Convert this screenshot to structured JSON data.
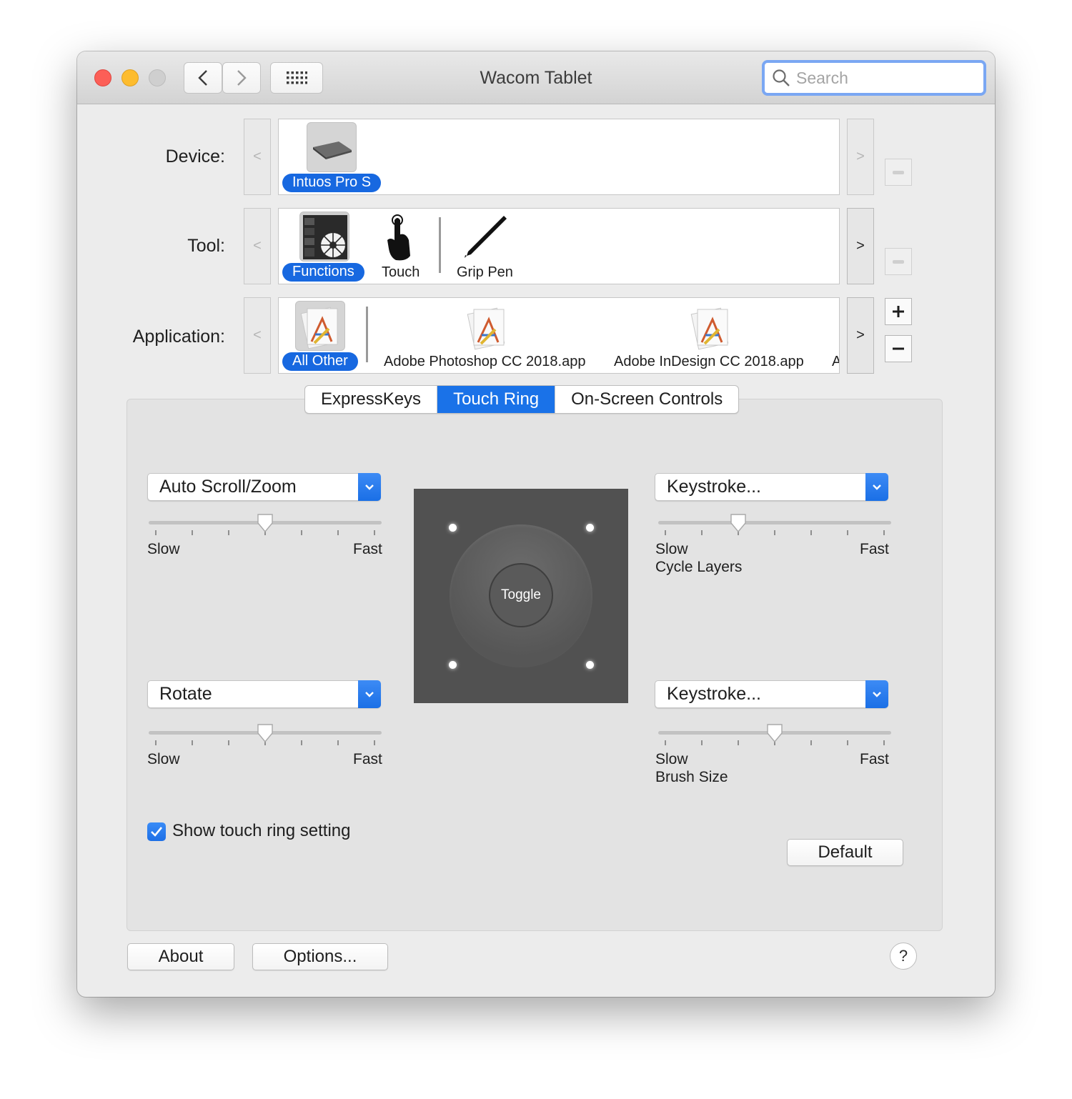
{
  "window": {
    "title": "Wacom Tablet"
  },
  "search": {
    "placeholder": "Search"
  },
  "device": {
    "label": "Device:",
    "items": [
      {
        "name": "Intuos Pro S",
        "selected": true
      }
    ]
  },
  "tool": {
    "label": "Tool:",
    "items": [
      {
        "name": "Functions",
        "selected": true
      },
      {
        "name": "Touch",
        "selected": false
      },
      {
        "name": "Grip Pen",
        "selected": false
      }
    ]
  },
  "application": {
    "label": "Application:",
    "items": [
      {
        "name": "All Other",
        "selected": true
      },
      {
        "name": "Adobe Photoshop CC 2018.app",
        "selected": false
      },
      {
        "name": "Adobe InDesign CC 2018.app",
        "selected": false
      },
      {
        "name": "A",
        "selected": false
      }
    ]
  },
  "tabs": [
    {
      "label": "ExpressKeys",
      "active": false
    },
    {
      "label": "Touch Ring",
      "active": true
    },
    {
      "label": "On-Screen Controls",
      "active": false
    }
  ],
  "touch_ring": {
    "top_left": {
      "function": "Auto Scroll/Zoom",
      "speed_fraction": 0.5,
      "slow": "Slow",
      "fast": "Fast",
      "caption": ""
    },
    "bottom_left": {
      "function": "Rotate",
      "speed_fraction": 0.5,
      "slow": "Slow",
      "fast": "Fast",
      "caption": ""
    },
    "top_right": {
      "function": "Keystroke...",
      "speed_fraction": 0.33,
      "slow": "Slow",
      "fast": "Fast",
      "caption": "Cycle Layers"
    },
    "bottom_right": {
      "function": "Keystroke...",
      "speed_fraction": 0.5,
      "slow": "Slow",
      "fast": "Fast",
      "caption": "Brush Size"
    },
    "center_label": "Toggle"
  },
  "show_setting": {
    "label": "Show touch ring setting",
    "checked": true
  },
  "buttons": {
    "default": "Default",
    "about": "About",
    "options": "Options...",
    "help": "?"
  },
  "colors": {
    "accent": "#1a72e8",
    "close": "#fc5f57",
    "minimize": "#fdbc2e"
  }
}
